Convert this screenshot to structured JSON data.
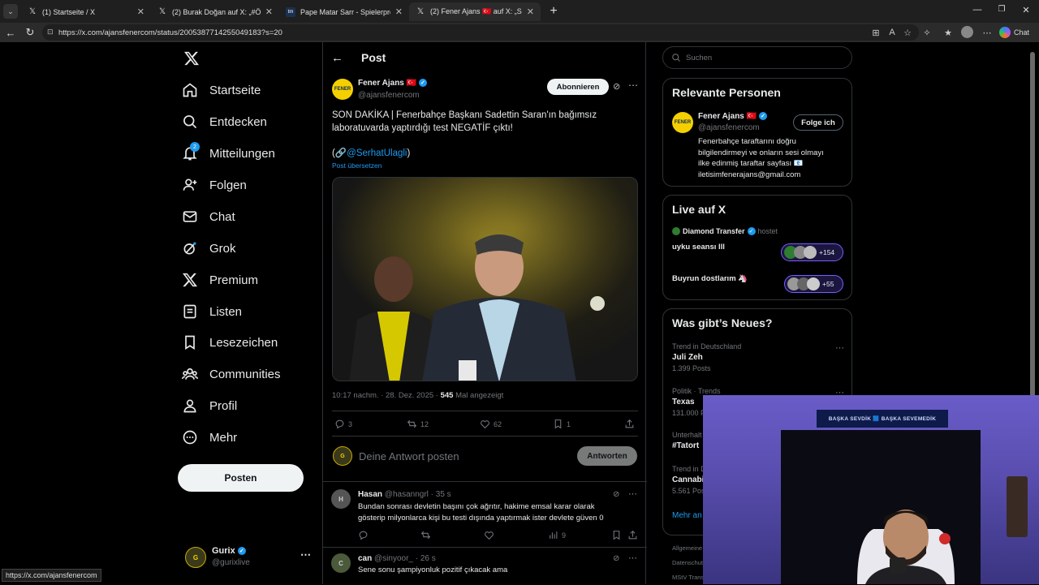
{
  "browser": {
    "tabs": [
      {
        "title": "(1) Startseite / X",
        "active": false
      },
      {
        "title": "(2) Burak Doğan auf X: „#ÖZELHABER",
        "active": false
      },
      {
        "title": "Pape Matar Sarr - Spielerprofil 25/26",
        "active": false
      },
      {
        "title": "(2) Fener Ajans 🇹🇷 auf X: „SON DAKİKA",
        "active": true
      }
    ],
    "url": "https://x.com/ajansfenercom/status/2005387714255049183?s=20",
    "chat_label": "Chat",
    "status_url": "https://x.com/ajansfenercom"
  },
  "nav": {
    "items": [
      {
        "label": "Startseite",
        "icon": "home-icon"
      },
      {
        "label": "Entdecken",
        "icon": "search-icon"
      },
      {
        "label": "Mitteilungen",
        "icon": "bell-icon",
        "badge": "2"
      },
      {
        "label": "Folgen",
        "icon": "person-add-icon"
      },
      {
        "label": "Chat",
        "icon": "mail-icon"
      },
      {
        "label": "Grok",
        "icon": "grok-icon"
      },
      {
        "label": "Premium",
        "icon": "x-logo-icon"
      },
      {
        "label": "Listen",
        "icon": "list-icon"
      },
      {
        "label": "Lesezeichen",
        "icon": "bookmark-icon"
      },
      {
        "label": "Communities",
        "icon": "people-icon"
      },
      {
        "label": "Profil",
        "icon": "profile-icon"
      },
      {
        "label": "Mehr",
        "icon": "more-circle-icon"
      }
    ],
    "post_button": "Posten",
    "account": {
      "name": "Gurix",
      "handle": "@gurixlive"
    }
  },
  "post": {
    "header": "Post",
    "author_name": "Fener Ajans",
    "flag": "🇹🇷",
    "author_handle": "@ajansfenercom",
    "subscribe": "Abonnieren",
    "text_line1": "SON DAKİKA | Fenerbahçe Başkanı Sadettin Saran'ın bağımsız",
    "text_line2": "laboratuvarda yaptırdığı test NEGATİF çıktı!",
    "mention_prefix": "(🔗",
    "mention": "@SerhatUlagli",
    "mention_suffix": ")",
    "translate": "Post übersetzen",
    "timestamp": "10:17 nachm. · 28. Dez. 2025 · ",
    "views": "545",
    "views_label": " Mal angezeigt",
    "stats": {
      "replies": "3",
      "reposts": "12",
      "likes": "62",
      "bookmarks": "1"
    },
    "reply_placeholder": "Deine Antwort posten",
    "reply_button": "Antworten"
  },
  "replies": [
    {
      "name": "Hasan",
      "handle": "@hasanngrl",
      "time": "· 35 s",
      "line1": "Bundan sonrası devletin başını çok ağrıtır, hakime emsal karar olarak",
      "line2": "gösterip milyonlarca kişi bu testi dışında yaptırmak ister devlete güven 0",
      "views": "9"
    },
    {
      "name": "can",
      "handle": "@sinyoor_",
      "time": "· 26 s",
      "line1": "Sene sonu şampiyonluk pozitif çıkacak ama",
      "line2": "",
      "views": ""
    }
  ],
  "sidebar": {
    "search_placeholder": "Suchen",
    "people": {
      "title": "Relevante Personen",
      "name": "Fener Ajans",
      "flag": "🇹🇷",
      "handle": "@ajansfenercom",
      "follow": "Folge ich",
      "bio1": "Fenerbahçe taraftarını doğru",
      "bio2": "bilgilendirmeyi ve onların sesi olmayı",
      "bio3": "ilke edinmiş taraftar sayfası 📧",
      "bio4": "iletisimfenerajans@gmail.com"
    },
    "live": {
      "title": "Live auf X",
      "host": "Diamond Transfer",
      "host_label": "hostet",
      "spaces": [
        {
          "title": "uyku seansı lll",
          "count": "+154"
        },
        {
          "title": "Buyrun dostlarım 🦄",
          "count": "+55"
        }
      ]
    },
    "trends": {
      "title": "Was gibt’s Neues?",
      "items": [
        {
          "context": "Trend in Deutschland",
          "name": "Juli Zeh",
          "posts": "1.399 Posts"
        },
        {
          "context": "Politik · Trends",
          "name": "Texas",
          "posts": "131.000 P"
        },
        {
          "context": "Unterhalt",
          "name": "#Tatort",
          "posts": ""
        },
        {
          "context": "Trend in D",
          "name": "Cannabi",
          "posts": "5.561 Pos"
        }
      ],
      "more": "Mehr an"
    },
    "footer": [
      "Allgemeine",
      "Datenschut",
      "MStV Trans"
    ],
    "webcam_banner": "BAŞKA SEVDİK 🟦 BAŞKA SEVEMEDİK"
  },
  "colors": {
    "accent": "#1d9bf0",
    "bg": "#000000",
    "border": "#2f3336",
    "muted": "#71767b"
  }
}
